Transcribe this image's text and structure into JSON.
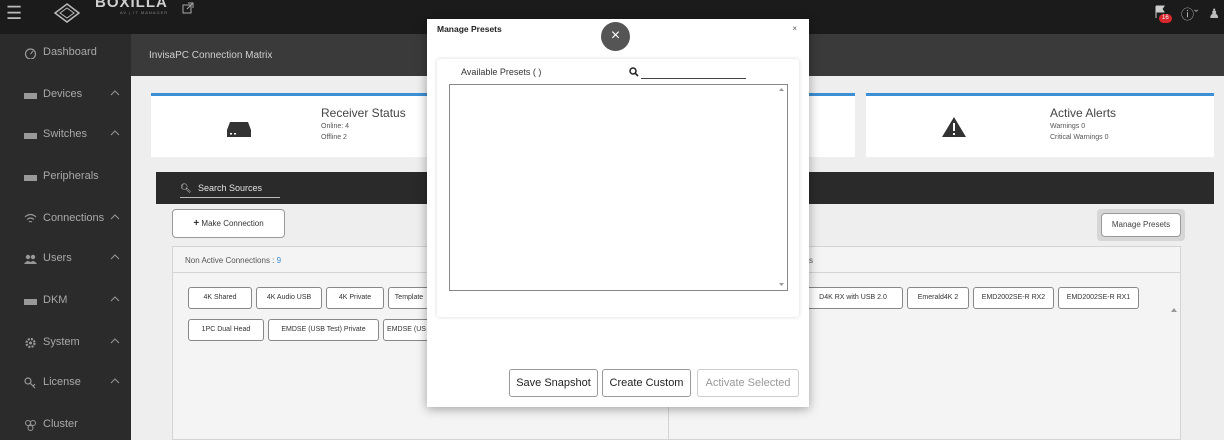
{
  "topbar": {
    "brand": "BOXILLA",
    "brand_sub": "AV | IT MANAGER",
    "alert_badge": "16"
  },
  "sidebar": {
    "items": [
      {
        "label": "Dashboard",
        "icon": "dashboard-icon",
        "chevron": false
      },
      {
        "label": "Devices",
        "icon": "device-icon",
        "chevron": true
      },
      {
        "label": "Switches",
        "icon": "switch-icon",
        "chevron": true
      },
      {
        "label": "Peripherals",
        "icon": "peripheral-icon",
        "chevron": false
      },
      {
        "label": "Connections",
        "icon": "wifi-icon",
        "chevron": true
      },
      {
        "label": "Users",
        "icon": "users-icon",
        "chevron": true
      },
      {
        "label": "DKM",
        "icon": "dkm-icon",
        "chevron": true
      },
      {
        "label": "System",
        "icon": "gear-icon",
        "chevron": true
      },
      {
        "label": "License",
        "icon": "key-icon",
        "chevron": true
      },
      {
        "label": "Cluster",
        "icon": "cluster-icon",
        "chevron": false
      }
    ]
  },
  "main": {
    "page_title": "InvisaPC Connection Matrix",
    "receiver_card": {
      "title": "Receiver Status",
      "line1": "Online: 4",
      "line2": "Offline 2"
    },
    "alerts_card": {
      "title": "Active Alerts",
      "line1": "Warnings 0",
      "line2": "Critical Warnings 0"
    },
    "search_sources": "Search Sources",
    "make_connection": "Make Connection",
    "manage_presets": "Manage Presets",
    "non_active_label": "Non Active Connections : ",
    "non_active_count": "9",
    "left_chips_row1": [
      "4K Shared",
      "4K Audio USB",
      "4K Private",
      "Template"
    ],
    "left_chips_row2": [
      "1PC Dual Head",
      "EMDSE (USB Test) Private",
      "EMDSE (US"
    ],
    "right_panel_label": "s",
    "right_chips": [
      "D4K RX with USB 2.0",
      "Emerald4K 2",
      "EMD2002SE-R RX2",
      "EMD2002SE-R RX1"
    ]
  },
  "modal": {
    "title": "Manage Presets",
    "x": "×",
    "close_circle": "×",
    "available_label": "Available Presets ( )",
    "search_value": "",
    "save_snapshot": "Save Snapshot",
    "create_custom": "Create Custom",
    "activate_selected": "Activate Selected"
  },
  "colors": {
    "accent": "#3b8fd4",
    "sidebar_bg": "#2b2b2b",
    "topbar_bg": "#1b1b1b",
    "badge": "#d8282d"
  }
}
